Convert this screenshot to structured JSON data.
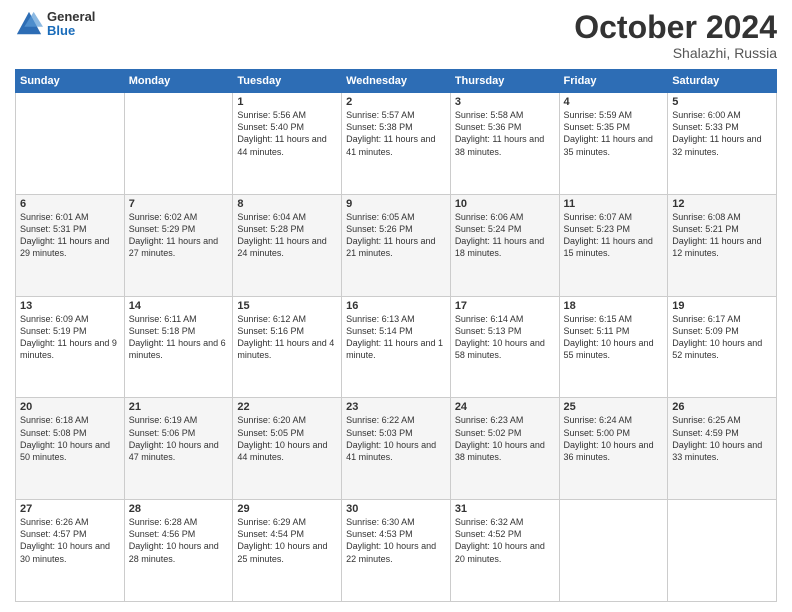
{
  "logo": {
    "general": "General",
    "blue": "Blue"
  },
  "header": {
    "month": "October 2024",
    "location": "Shalazhi, Russia"
  },
  "days_of_week": [
    "Sunday",
    "Monday",
    "Tuesday",
    "Wednesday",
    "Thursday",
    "Friday",
    "Saturday"
  ],
  "weeks": [
    [
      {
        "day": "",
        "info": ""
      },
      {
        "day": "",
        "info": ""
      },
      {
        "day": "1",
        "info": "Sunrise: 5:56 AM\nSunset: 5:40 PM\nDaylight: 11 hours and 44 minutes."
      },
      {
        "day": "2",
        "info": "Sunrise: 5:57 AM\nSunset: 5:38 PM\nDaylight: 11 hours and 41 minutes."
      },
      {
        "day": "3",
        "info": "Sunrise: 5:58 AM\nSunset: 5:36 PM\nDaylight: 11 hours and 38 minutes."
      },
      {
        "day": "4",
        "info": "Sunrise: 5:59 AM\nSunset: 5:35 PM\nDaylight: 11 hours and 35 minutes."
      },
      {
        "day": "5",
        "info": "Sunrise: 6:00 AM\nSunset: 5:33 PM\nDaylight: 11 hours and 32 minutes."
      }
    ],
    [
      {
        "day": "6",
        "info": "Sunrise: 6:01 AM\nSunset: 5:31 PM\nDaylight: 11 hours and 29 minutes."
      },
      {
        "day": "7",
        "info": "Sunrise: 6:02 AM\nSunset: 5:29 PM\nDaylight: 11 hours and 27 minutes."
      },
      {
        "day": "8",
        "info": "Sunrise: 6:04 AM\nSunset: 5:28 PM\nDaylight: 11 hours and 24 minutes."
      },
      {
        "day": "9",
        "info": "Sunrise: 6:05 AM\nSunset: 5:26 PM\nDaylight: 11 hours and 21 minutes."
      },
      {
        "day": "10",
        "info": "Sunrise: 6:06 AM\nSunset: 5:24 PM\nDaylight: 11 hours and 18 minutes."
      },
      {
        "day": "11",
        "info": "Sunrise: 6:07 AM\nSunset: 5:23 PM\nDaylight: 11 hours and 15 minutes."
      },
      {
        "day": "12",
        "info": "Sunrise: 6:08 AM\nSunset: 5:21 PM\nDaylight: 11 hours and 12 minutes."
      }
    ],
    [
      {
        "day": "13",
        "info": "Sunrise: 6:09 AM\nSunset: 5:19 PM\nDaylight: 11 hours and 9 minutes."
      },
      {
        "day": "14",
        "info": "Sunrise: 6:11 AM\nSunset: 5:18 PM\nDaylight: 11 hours and 6 minutes."
      },
      {
        "day": "15",
        "info": "Sunrise: 6:12 AM\nSunset: 5:16 PM\nDaylight: 11 hours and 4 minutes."
      },
      {
        "day": "16",
        "info": "Sunrise: 6:13 AM\nSunset: 5:14 PM\nDaylight: 11 hours and 1 minute."
      },
      {
        "day": "17",
        "info": "Sunrise: 6:14 AM\nSunset: 5:13 PM\nDaylight: 10 hours and 58 minutes."
      },
      {
        "day": "18",
        "info": "Sunrise: 6:15 AM\nSunset: 5:11 PM\nDaylight: 10 hours and 55 minutes."
      },
      {
        "day": "19",
        "info": "Sunrise: 6:17 AM\nSunset: 5:09 PM\nDaylight: 10 hours and 52 minutes."
      }
    ],
    [
      {
        "day": "20",
        "info": "Sunrise: 6:18 AM\nSunset: 5:08 PM\nDaylight: 10 hours and 50 minutes."
      },
      {
        "day": "21",
        "info": "Sunrise: 6:19 AM\nSunset: 5:06 PM\nDaylight: 10 hours and 47 minutes."
      },
      {
        "day": "22",
        "info": "Sunrise: 6:20 AM\nSunset: 5:05 PM\nDaylight: 10 hours and 44 minutes."
      },
      {
        "day": "23",
        "info": "Sunrise: 6:22 AM\nSunset: 5:03 PM\nDaylight: 10 hours and 41 minutes."
      },
      {
        "day": "24",
        "info": "Sunrise: 6:23 AM\nSunset: 5:02 PM\nDaylight: 10 hours and 38 minutes."
      },
      {
        "day": "25",
        "info": "Sunrise: 6:24 AM\nSunset: 5:00 PM\nDaylight: 10 hours and 36 minutes."
      },
      {
        "day": "26",
        "info": "Sunrise: 6:25 AM\nSunset: 4:59 PM\nDaylight: 10 hours and 33 minutes."
      }
    ],
    [
      {
        "day": "27",
        "info": "Sunrise: 6:26 AM\nSunset: 4:57 PM\nDaylight: 10 hours and 30 minutes."
      },
      {
        "day": "28",
        "info": "Sunrise: 6:28 AM\nSunset: 4:56 PM\nDaylight: 10 hours and 28 minutes."
      },
      {
        "day": "29",
        "info": "Sunrise: 6:29 AM\nSunset: 4:54 PM\nDaylight: 10 hours and 25 minutes."
      },
      {
        "day": "30",
        "info": "Sunrise: 6:30 AM\nSunset: 4:53 PM\nDaylight: 10 hours and 22 minutes."
      },
      {
        "day": "31",
        "info": "Sunrise: 6:32 AM\nSunset: 4:52 PM\nDaylight: 10 hours and 20 minutes."
      },
      {
        "day": "",
        "info": ""
      },
      {
        "day": "",
        "info": ""
      }
    ]
  ]
}
